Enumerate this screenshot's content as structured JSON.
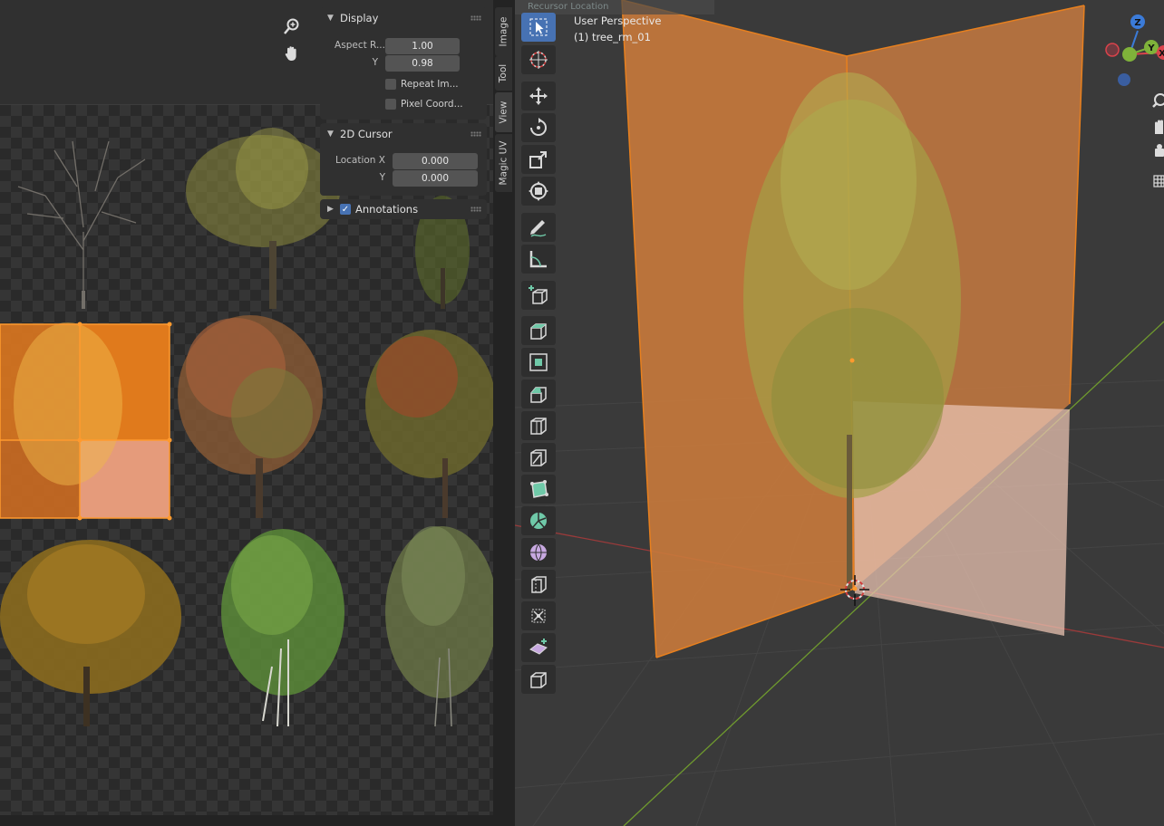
{
  "image_editor": {
    "sidebar_tabs": [
      "Image",
      "Tool",
      "View",
      "Magic UV"
    ],
    "display_panel": {
      "title": "Display",
      "aspect_label": "Aspect R...",
      "aspect_x": "1.00",
      "y_label": "Y",
      "aspect_y": "0.98",
      "repeat_label": "Repeat Im...",
      "pixel_label": "Pixel Coord..."
    },
    "cursor_panel": {
      "title": "2D Cursor",
      "loc_x_label": "Location X",
      "loc_x": "0.000",
      "loc_y_label": "Y",
      "loc_y": "0.000"
    },
    "annotations_panel": {
      "title": "Annotations"
    }
  },
  "viewport": {
    "top_strip_text": "Recursor Location",
    "perspective": "User Perspective",
    "object_name": "(1) tree_rm_01",
    "gizmo_labels": {
      "z": "Z",
      "y": "Y",
      "x": "X"
    },
    "colors": {
      "selection": "#e87d1e",
      "active_tool": "#4772b3",
      "x_axis": "#d9434b",
      "y_axis": "#7fb23a",
      "z_axis": "#3b7bd8"
    }
  }
}
